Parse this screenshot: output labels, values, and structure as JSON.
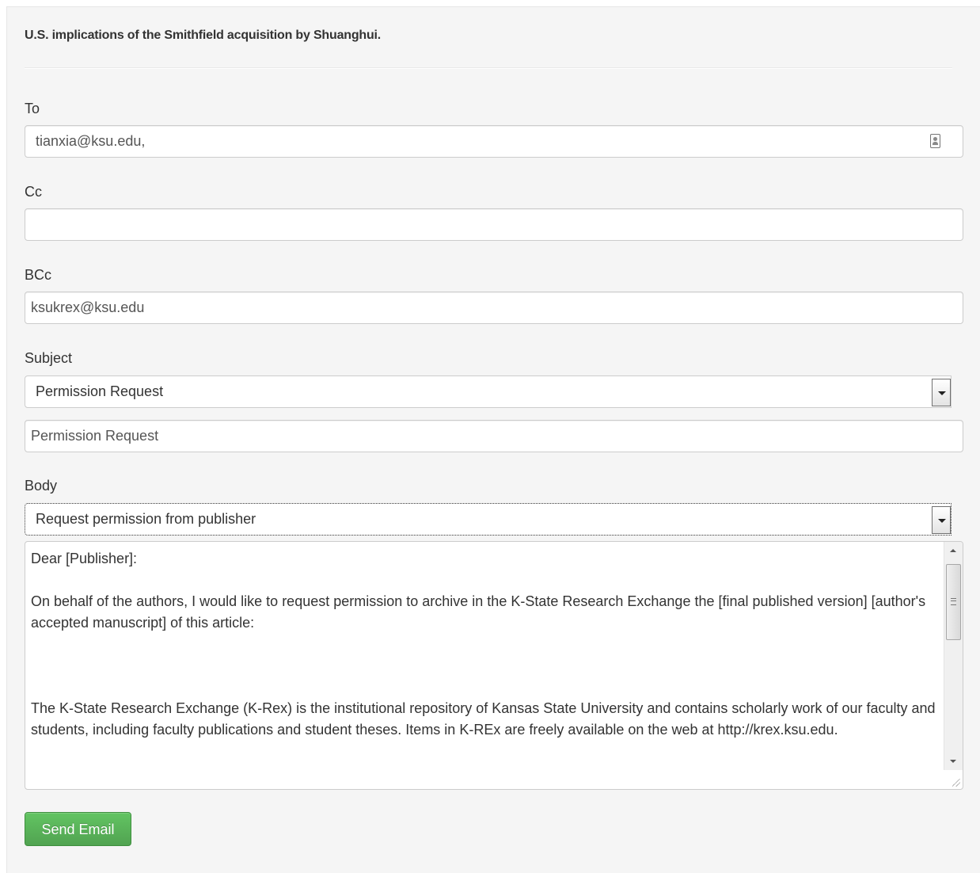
{
  "page": {
    "title": "U.S. implications of the Smithfield acquisition by Shuanghui."
  },
  "form": {
    "to": {
      "label": "To",
      "value": "tianxia@ksu.edu,"
    },
    "cc": {
      "label": "Cc",
      "value": ""
    },
    "bcc": {
      "label": "BCc",
      "value": "ksukrex@ksu.edu"
    },
    "subject": {
      "label": "Subject",
      "selected": "Permission Request",
      "value": "Permission Request"
    },
    "body": {
      "label": "Body",
      "selected": "Request permission from publisher",
      "paragraphs": [
        "Dear [Publisher]:",
        "On behalf of the authors, I would like to request permission to archive in the K-State Research Exchange the [final published version] [author's accepted manuscript] of this article:",
        "The K-State Research Exchange (K-Rex) is the institutional repository of Kansas State University and contains scholarly work of our faculty and students, including faculty publications and student theses. Items in K-REx are freely available on the web at http://krex.ksu.edu."
      ]
    },
    "send_label": "Send Email"
  },
  "icons": {
    "contacts": "address-book-icon",
    "dropdown": "chevron-down-icon",
    "scroll_up": "arrow-up-icon",
    "scroll_down": "arrow-down-icon",
    "resize": "resize-grip-icon"
  },
  "colors": {
    "panel_background": "#f5f5f5",
    "send_button": "#5bb75b",
    "text": "#333333"
  }
}
